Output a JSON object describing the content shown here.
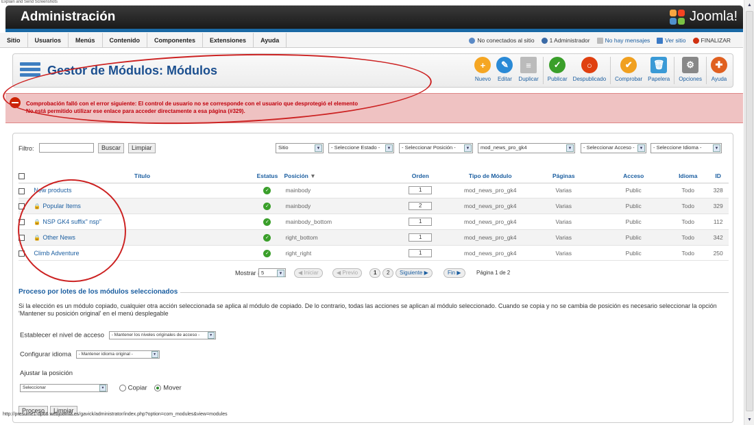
{
  "caption": "Explain and Send Screenshots",
  "header": {
    "title": "Administración",
    "logo": "Joomla!"
  },
  "menu": [
    "Sitio",
    "Usuarios",
    "Menús",
    "Contenido",
    "Componentes",
    "Extensiones",
    "Ayuda"
  ],
  "status": {
    "online": "No conectados al sitio",
    "admins": "1 Administrador",
    "messages": "No hay mensajes",
    "view_site": "Ver sitio",
    "logout": "FINALIZAR"
  },
  "toolbar": {
    "title": "Gestor de Módulos: Módulos",
    "buttons": [
      {
        "label": "Nuevo",
        "icon": "plus-icon",
        "color": "#f5a623"
      },
      {
        "label": "Editar",
        "icon": "pencil-icon",
        "color": "#2a8ad6"
      },
      {
        "label": "Duplicar",
        "icon": "copy-icon",
        "color": "#bbbbbb"
      },
      {
        "label": "Publicar",
        "icon": "check-icon",
        "color": "#3a9f2a"
      },
      {
        "label": "Despublicado",
        "icon": "unpublish-icon",
        "color": "#e04010"
      },
      {
        "label": "Comprobar",
        "icon": "checkin-icon",
        "color": "#f0a020"
      },
      {
        "label": "Papelera",
        "icon": "trash-icon",
        "color": "#3a9ad6"
      },
      {
        "label": "Opciones",
        "icon": "options-icon",
        "color": "#888888"
      },
      {
        "label": "Ayuda",
        "icon": "help-icon",
        "color": "#e06020"
      }
    ]
  },
  "error": {
    "line1": "Comprobación falló con el error siguiente: El control de usuario no se corresponde con el usuario que desprotegió el elemento",
    "line2": "No está permitido utilizar ese enlace para acceder directamente a esa página (#329)."
  },
  "filter": {
    "label": "Filtro:",
    "value": "",
    "search_btn": "Buscar",
    "clear_btn": "Limpiar",
    "site": "Sitio",
    "state": "- Seleccione Estado -",
    "position": "- Seleccionar Posición -",
    "type": "mod_news_pro_gk4",
    "access": "- Seleccionar Acceso -",
    "language": "- Seleccione Idioma -"
  },
  "table": {
    "headers": [
      "Título",
      "Estatus",
      "Posición",
      "Orden",
      "Tipo de Módulo",
      "Páginas",
      "Acceso",
      "Idioma",
      "ID"
    ],
    "rows": [
      {
        "title": "New products",
        "locked": false,
        "position": "mainbody",
        "order": "1",
        "type": "mod_news_pro_gk4",
        "pages": "Varias",
        "access": "Public",
        "language": "Todo",
        "id": "328"
      },
      {
        "title": "Popular Items",
        "locked": true,
        "position": "mainbody",
        "order": "2",
        "type": "mod_news_pro_gk4",
        "pages": "Varias",
        "access": "Public",
        "language": "Todo",
        "id": "329"
      },
      {
        "title": "NSP GK4 suffix\" nsp\"",
        "locked": true,
        "position": "mainbody_bottom",
        "order": "1",
        "type": "mod_news_pro_gk4",
        "pages": "Varias",
        "access": "Public",
        "language": "Todo",
        "id": "112"
      },
      {
        "title": "Other News",
        "locked": true,
        "position": "right_bottom",
        "order": "1",
        "type": "mod_news_pro_gk4",
        "pages": "Varias",
        "access": "Public",
        "language": "Todo",
        "id": "342"
      },
      {
        "title": "Climb Adventure",
        "locked": false,
        "position": "right_right",
        "order": "1",
        "type": "mod_news_pro_gk4",
        "pages": "Varias",
        "access": "Public",
        "language": "Todo",
        "id": "250"
      }
    ]
  },
  "pagination": {
    "show_label": "Mostrar #",
    "show_value": "5",
    "start": "Iniciar",
    "prev": "Previo",
    "pages": [
      "1",
      "2"
    ],
    "next": "Siguiente",
    "end": "Fin",
    "info": "Página 1 de 2"
  },
  "batch": {
    "legend": "Proceso por lotes de los módulos seleccionados",
    "desc": "Si la elección es un módulo copiado, cualquier otra acción seleccionada se aplica al módulo de copiado. De lo contrario, todas las acciones se aplican al módulo seleccionado. Cuando se copia y no se cambia de posición es necesario seleccionar la opción 'Mantener su posición original' en el menú desplegable",
    "access_label": "Establecer el nivel de acceso",
    "access_value": "- Mantener los niveles originales de acceso -",
    "lang_label": "Configurar idioma",
    "lang_value": "- Mantener idioma original -",
    "pos_label": "Ajustar la posición",
    "pos_value": "Seleccionar",
    "copy": "Copiar",
    "move": "Mover",
    "selected_mode": "Mover",
    "process_btn": "Proceso",
    "clear_btn": "Limpiar"
  },
  "statusbar": "http://presume1-dp66.webjoomla.es/gavick/administrator/index.php?option=com_modules&view=modules"
}
